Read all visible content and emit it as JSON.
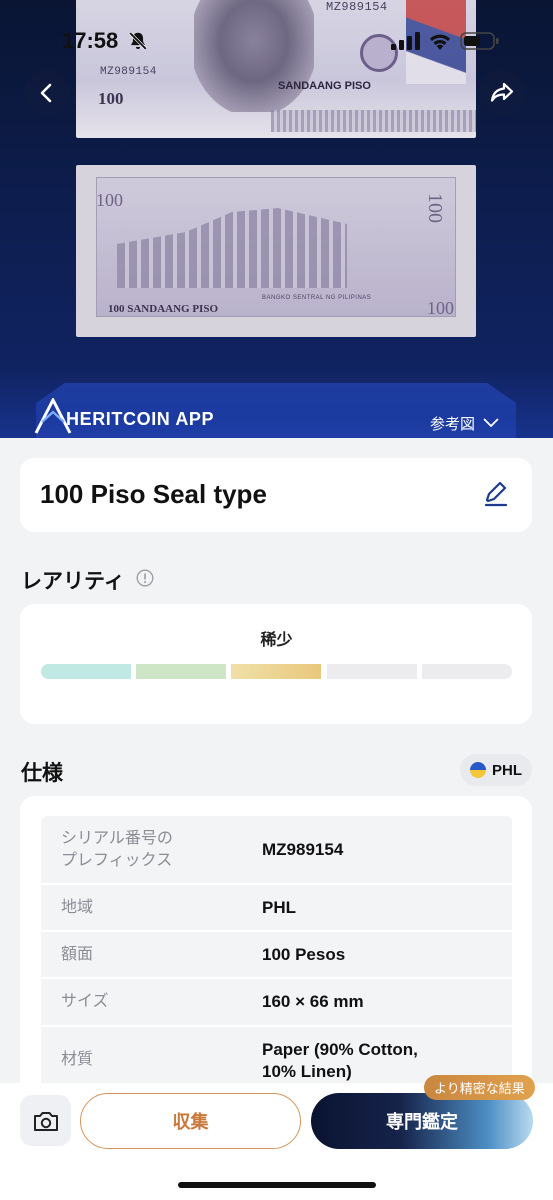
{
  "status_bar": {
    "time": "17:58"
  },
  "banknote": {
    "front_serial": "MZ989154",
    "front_serial_left": "MZ989154",
    "front_denomination": "100",
    "front_name": "SANDAANG PISO",
    "back_denomination": "100",
    "back_text": "100 SANDAANG PISO",
    "back_bank": "BANGKO SENTRAL NG PILIPINAS"
  },
  "brand": {
    "name": "HERITCOIN APP",
    "reference_label": "参考図",
    "accent": "#1f3d9f"
  },
  "item": {
    "title": "100 Piso Seal type"
  },
  "rarity": {
    "heading": "レアリティ",
    "level_label": "稀少",
    "level": 3,
    "max_level": 5,
    "segment_colors": [
      "#bfe9e2",
      "#cfe6c6",
      "#e8c87c",
      "#ececee",
      "#ececee"
    ]
  },
  "specs": {
    "heading": "仕様",
    "country_code": "PHL",
    "rows": [
      {
        "key": "シリアル番号の\nプレフィックス",
        "value": "MZ989154"
      },
      {
        "key": "地域",
        "value": "PHL"
      },
      {
        "key": "額面",
        "value": "100 Pesos"
      },
      {
        "key": "サイズ",
        "value": "160 × 66 mm"
      },
      {
        "key": "材質",
        "value": "Paper (90% Cotton,\n10% Linen)"
      }
    ]
  },
  "actions": {
    "collect_label": "収集",
    "expert_label": "専門鑑定",
    "expert_badge": "より精密な結果",
    "collect_color": "#c9783a"
  },
  "icons": [
    "bell-slash-icon",
    "signal-icon",
    "wifi-icon",
    "battery-icon",
    "chevron-left-icon",
    "share-icon",
    "edit-icon",
    "info-icon",
    "chevron-down-icon",
    "camera-icon"
  ]
}
